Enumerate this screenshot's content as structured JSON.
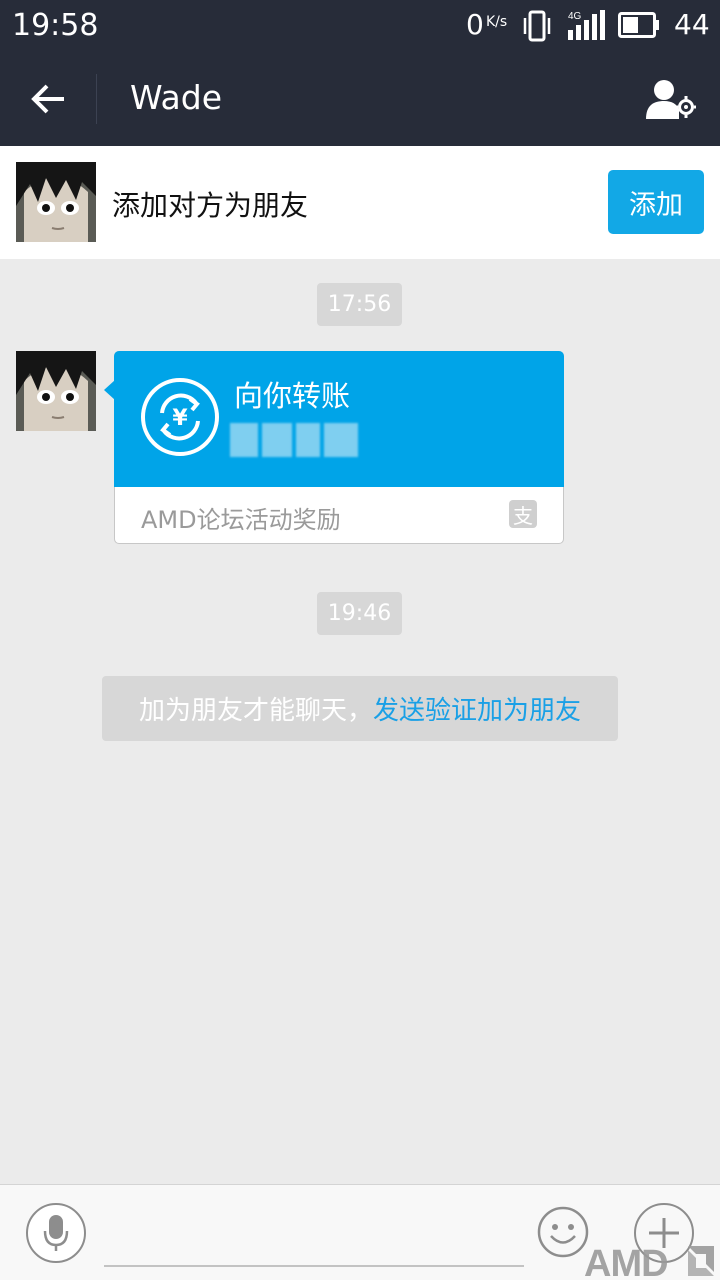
{
  "status_bar": {
    "time": "19:58",
    "net_speed": "0",
    "net_speed_unit": "K/s",
    "network": "4G",
    "battery_level": "44"
  },
  "header": {
    "title": "Wade",
    "back_icon": "arrow-left-icon",
    "settings_icon": "contact-settings-icon"
  },
  "add_friend_bar": {
    "text": "添加对方为朋友",
    "button_label": "添加"
  },
  "messages": [
    {
      "type": "time",
      "text": "17:56"
    },
    {
      "type": "transfer",
      "title": "向你转账",
      "note": "AMD论坛活动奖励",
      "badge": "支"
    },
    {
      "type": "time",
      "text": "19:46"
    },
    {
      "type": "notice",
      "text": "加为朋友才能聊天，",
      "link": "发送验证加为朋友"
    }
  ],
  "input_bar": {
    "voice_icon": "microphone-icon",
    "emoji_icon": "smiley-icon",
    "more_icon": "plus-icon"
  },
  "watermark": "AMD",
  "colors": {
    "header_bg": "#272c39",
    "accent": "#12a8e6",
    "transfer_bg": "#00a4e8",
    "chat_bg": "#ebebeb"
  }
}
